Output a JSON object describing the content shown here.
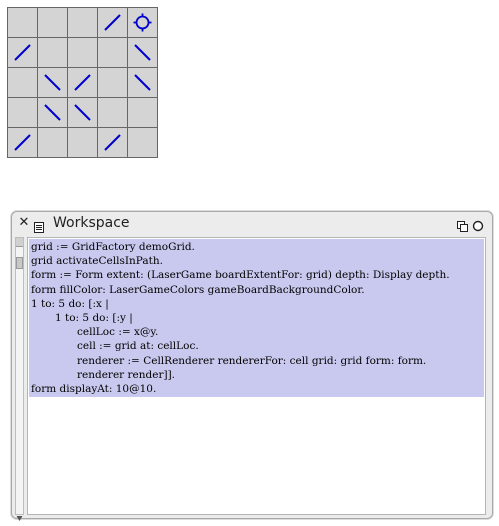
{
  "board": {
    "rows": [
      [
        "empty",
        "empty",
        "empty",
        "mirror-slash",
        "target"
      ],
      [
        "mirror-slash",
        "empty",
        "empty",
        "empty",
        "mirror-backslash"
      ],
      [
        "empty",
        "mirror-backslash",
        "mirror-slash",
        "empty",
        "mirror-backslash"
      ],
      [
        "empty",
        "mirror-backslash",
        "mirror-backslash",
        "empty",
        "empty"
      ],
      [
        "mirror-slash",
        "empty",
        "empty",
        "mirror-slash",
        "empty"
      ]
    ],
    "colors": {
      "cell": "#d4d4d4",
      "grid_line": "#666666",
      "mirror": "#0000cc",
      "target": "#0000cc"
    }
  },
  "workspace": {
    "title": "Workspace",
    "close_icon": "close-icon",
    "menu_icon": "window-menu-icon",
    "collapse_icon": "collapse-icon",
    "expand_icon": "expand-icon",
    "selection_color": "#c9c9ef",
    "code_lines": [
      "grid := GridFactory demoGrid.",
      "grid activateCellsInPath.",
      "form := Form extent: (LaserGame boardExtentFor: grid) depth: Display depth.",
      "form fillColor: LaserGameColors gameBoardBackgroundColor.",
      "1 to: 5 do: [:x |",
      "1 to: 5 do: [:y |",
      "cellLoc := x@y.",
      "cell := grid at: cellLoc.",
      "renderer := CellRenderer rendererFor: cell grid: grid form: form.",
      "renderer render]].",
      "form displayAt: 10@10."
    ],
    "code_indents": [
      0,
      0,
      0,
      0,
      0,
      1,
      2,
      2,
      2,
      2,
      0
    ]
  }
}
